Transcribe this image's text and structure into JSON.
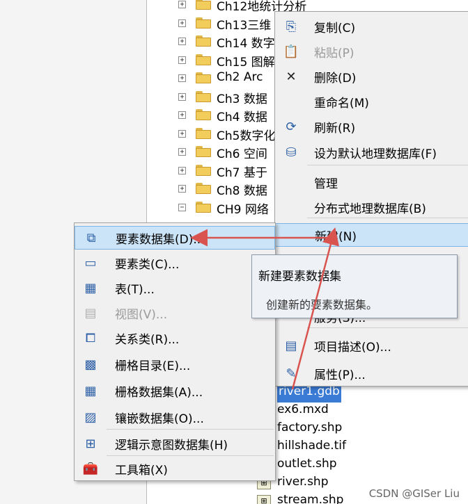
{
  "tree": {
    "folders": [
      {
        "label": "Ch12地统计分析",
        "expander": "+"
      },
      {
        "label": "Ch13三维",
        "expander": "+"
      },
      {
        "label": "Ch14 数字",
        "expander": "+"
      },
      {
        "label": "Ch15 图解",
        "expander": "+"
      },
      {
        "label": "Ch2  Arc",
        "expander": "+"
      },
      {
        "label": "Ch3 数据",
        "expander": "+"
      },
      {
        "label": "Ch4 数据",
        "expander": "+"
      },
      {
        "label": "Ch5数字化",
        "expander": "+"
      },
      {
        "label": "Ch6 空间",
        "expander": "+"
      },
      {
        "label": "Ch7 基于",
        "expander": "+"
      },
      {
        "label": "Ch8 数据",
        "expander": "+"
      },
      {
        "label": "CH9 网络",
        "expander": "−"
      }
    ],
    "files": [
      {
        "label": "river1.gdb",
        "selected": true
      },
      {
        "label": "ex6.mxd"
      },
      {
        "label": "factory.shp"
      },
      {
        "label": "hillshade.tif"
      },
      {
        "label": "outlet.shp"
      },
      {
        "label": "river.shp"
      },
      {
        "label": "stream.shp"
      }
    ]
  },
  "context_menu": {
    "items": [
      {
        "label": "复制(C)",
        "icon": "copy-icon",
        "glyph": "⎘",
        "disabled": false
      },
      {
        "label": "粘贴(P)",
        "icon": "paste-icon",
        "glyph": "📋",
        "disabled": true
      },
      {
        "label": "删除(D)",
        "icon": "delete-icon",
        "glyph": "✕",
        "disabled": false
      },
      {
        "label": "重命名(M)",
        "icon": "",
        "glyph": "",
        "disabled": false
      },
      {
        "label": "刷新(R)",
        "icon": "refresh-icon",
        "glyph": "⟳",
        "disabled": false
      },
      {
        "label": "设为默认地理数据库(F)",
        "icon": "default-database-icon",
        "glyph": "⛁",
        "disabled": false
      },
      {
        "label": "管理",
        "icon": "",
        "glyph": "",
        "disabled": false
      },
      {
        "label": "分布式地理数据库(B)",
        "icon": "",
        "glyph": "",
        "disabled": false
      },
      {
        "label": "新建(N)",
        "icon": "",
        "glyph": "",
        "disabled": false,
        "highlighted": true
      },
      {
        "label": "服务(S)...",
        "icon": "",
        "glyph": "",
        "disabled": false
      },
      {
        "label": "项目描述(O)...",
        "icon": "item-description-icon",
        "glyph": "▤",
        "disabled": false
      },
      {
        "label": "属性(P)...",
        "icon": "properties-icon",
        "glyph": "✎",
        "disabled": false
      }
    ]
  },
  "new_submenu": {
    "items": [
      {
        "label": "要素数据集(D)...",
        "icon": "feature-dataset-icon",
        "disabled": false,
        "highlighted": true
      },
      {
        "label": "要素类(C)...",
        "icon": "feature-class-icon",
        "disabled": false
      },
      {
        "label": "表(T)...",
        "icon": "table-icon",
        "disabled": false
      },
      {
        "label": "视图(V)...",
        "icon": "view-icon",
        "disabled": true
      },
      {
        "label": "关系类(R)...",
        "icon": "relationship-class-icon",
        "disabled": false
      },
      {
        "label": "栅格目录(E)...",
        "icon": "raster-catalog-icon",
        "disabled": false
      },
      {
        "label": "栅格数据集(A)...",
        "icon": "raster-dataset-icon",
        "disabled": false
      },
      {
        "label": "镶嵌数据集(O)...",
        "icon": "mosaic-dataset-icon",
        "disabled": false
      },
      {
        "label": "逻辑示意图数据集(H)",
        "icon": "schematic-dataset-icon",
        "disabled": false
      },
      {
        "label": "工具箱(X)",
        "icon": "toolbox-icon",
        "disabled": false
      }
    ]
  },
  "tooltip": {
    "title": "新建要素数据集",
    "description": "创建新的要素数据集。"
  },
  "watermark": "CSDN @GISer Liu",
  "colors": {
    "highlight_bg": "#cce4f7",
    "highlight_border": "#7fb5e5",
    "annotation_arrow": "#d9534f",
    "selection": "#3a7bd5"
  }
}
